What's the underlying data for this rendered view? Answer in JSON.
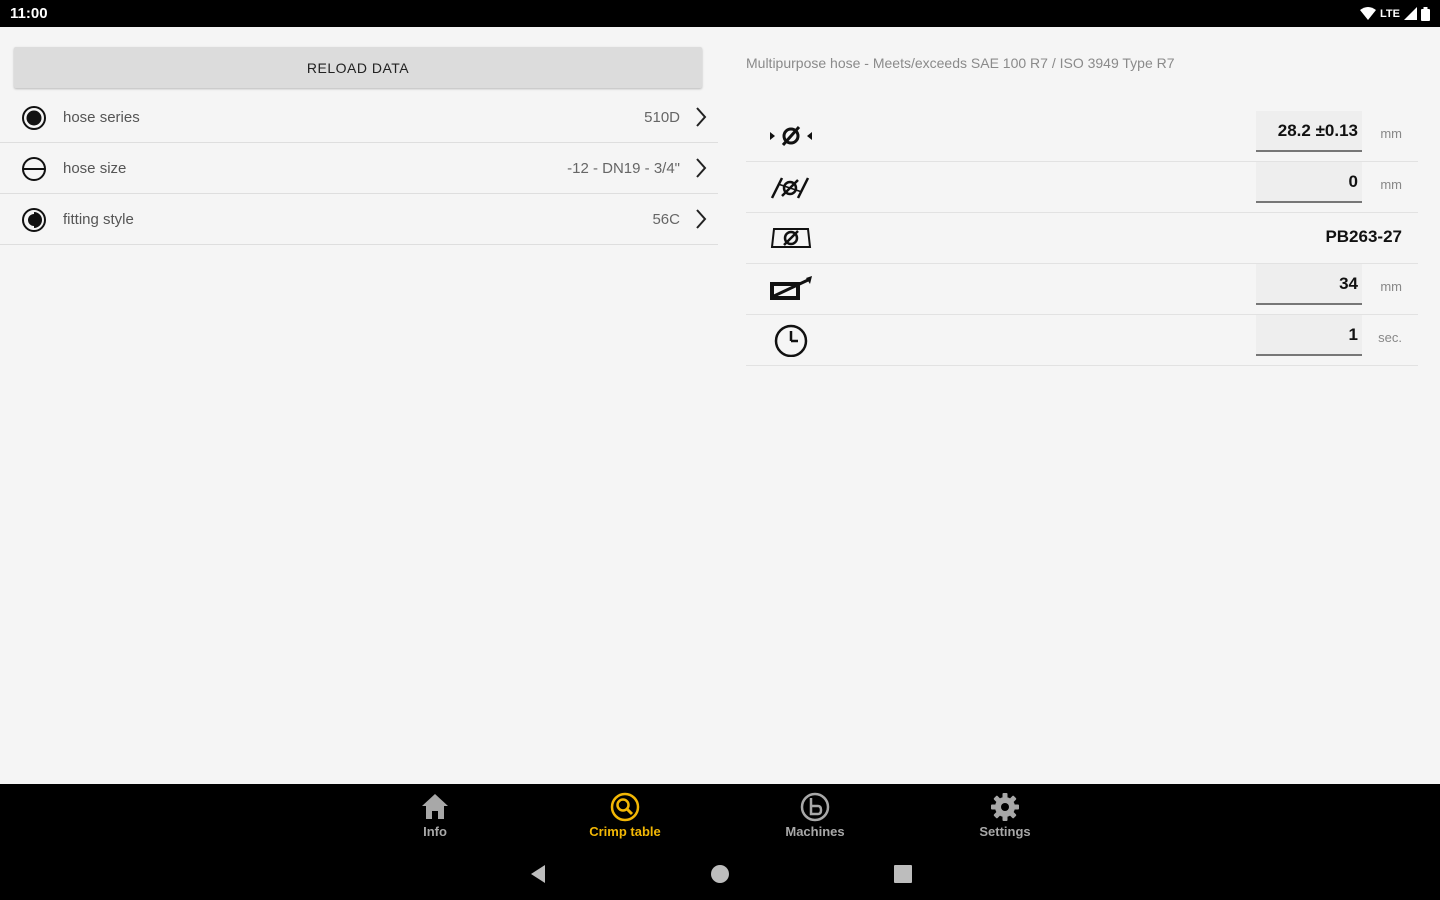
{
  "status_bar": {
    "time": "11:00",
    "network": "LTE",
    "icons": [
      "wifi-icon",
      "cell-signal-icon",
      "battery-icon"
    ]
  },
  "left_pane": {
    "reload_label": "RELOAD DATA",
    "selectors": [
      {
        "icon": "hose-series-icon",
        "label": "hose series",
        "value": "510D"
      },
      {
        "icon": "hose-size-icon",
        "label": "hose size",
        "value": "-12 - DN19 - 3/4\""
      },
      {
        "icon": "fitting-style-icon",
        "label": "fitting style",
        "value": "56C"
      }
    ]
  },
  "right_pane": {
    "description": "Multipurpose hose - Meets/exceeds SAE 100 R7 / ISO 3949 Type R7",
    "params": [
      {
        "icon": "crimp-diameter-icon",
        "value": "28.2 ±0.13",
        "unit": "mm"
      },
      {
        "icon": "skive-icon",
        "value": "0",
        "unit": "mm"
      },
      {
        "icon": "die-set-icon",
        "value": "PB263-27",
        "unit": ""
      },
      {
        "icon": "insertion-depth-icon",
        "value": "34",
        "unit": "mm"
      },
      {
        "icon": "timer-icon",
        "value": "1",
        "unit": "sec."
      }
    ]
  },
  "bottom_nav": {
    "active_color": "#f2b705",
    "inactive_color": "#a8a8a8",
    "items": [
      {
        "icon": "home-icon",
        "label": "Info",
        "active": false
      },
      {
        "icon": "crimp-table-icon",
        "label": "Crimp table",
        "active": true
      },
      {
        "icon": "machines-icon",
        "label": "Machines",
        "active": false
      },
      {
        "icon": "gear-icon",
        "label": "Settings",
        "active": false
      }
    ]
  },
  "system_nav": [
    "back-icon",
    "home-circle-icon",
    "recents-icon"
  ]
}
